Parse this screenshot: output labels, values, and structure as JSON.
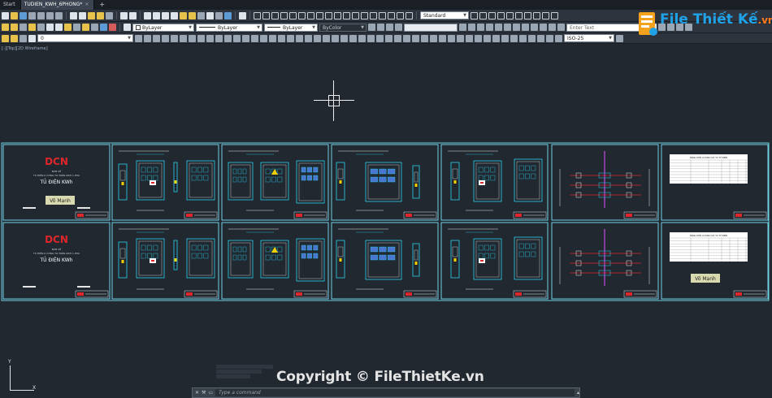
{
  "tabs": [
    {
      "label": "Start",
      "active": false
    },
    {
      "label": "TUDIEN_KWH_6PHONG*",
      "active": true
    }
  ],
  "toolbar": {
    "text_style": "Standard",
    "dim_style": "ISO-25",
    "search_placeholder": "Enter Text",
    "layer_name": "0",
    "color": "ByLayer",
    "linetype": "ByLayer",
    "lineweight": "ByLayer",
    "plotstyle": "ByColor"
  },
  "viewport_label": "[-][Top][2D Wireframe]",
  "command": {
    "placeholder": "Type a command"
  },
  "sheets": {
    "title_sheet_logo": "DCN",
    "title_sheet_subtitle": "TỦ ĐIỆN 6 CÔNG TƠ ĐIỆN KWH 1 PHA",
    "title_sheet_name": "TỦ ĐIỆN KWh",
    "title_sheet_author_small": "BẢN VẼ",
    "author_stamp": "Võ Mạnh",
    "table_title": "BẢNG KHỐI LƯỢNG VẬT TƯ TỦ ĐIỆN"
  },
  "watermark": {
    "copyright": "Copyright © FileThietKe.vn",
    "logo_text": "File Thiết Kế",
    "logo_suffix": ".vn"
  },
  "colors": {
    "background": "#212830",
    "sheet_border": "#6fd0e6",
    "accent_red": "#e0262b",
    "accent_cyan": "#29d3f0"
  }
}
